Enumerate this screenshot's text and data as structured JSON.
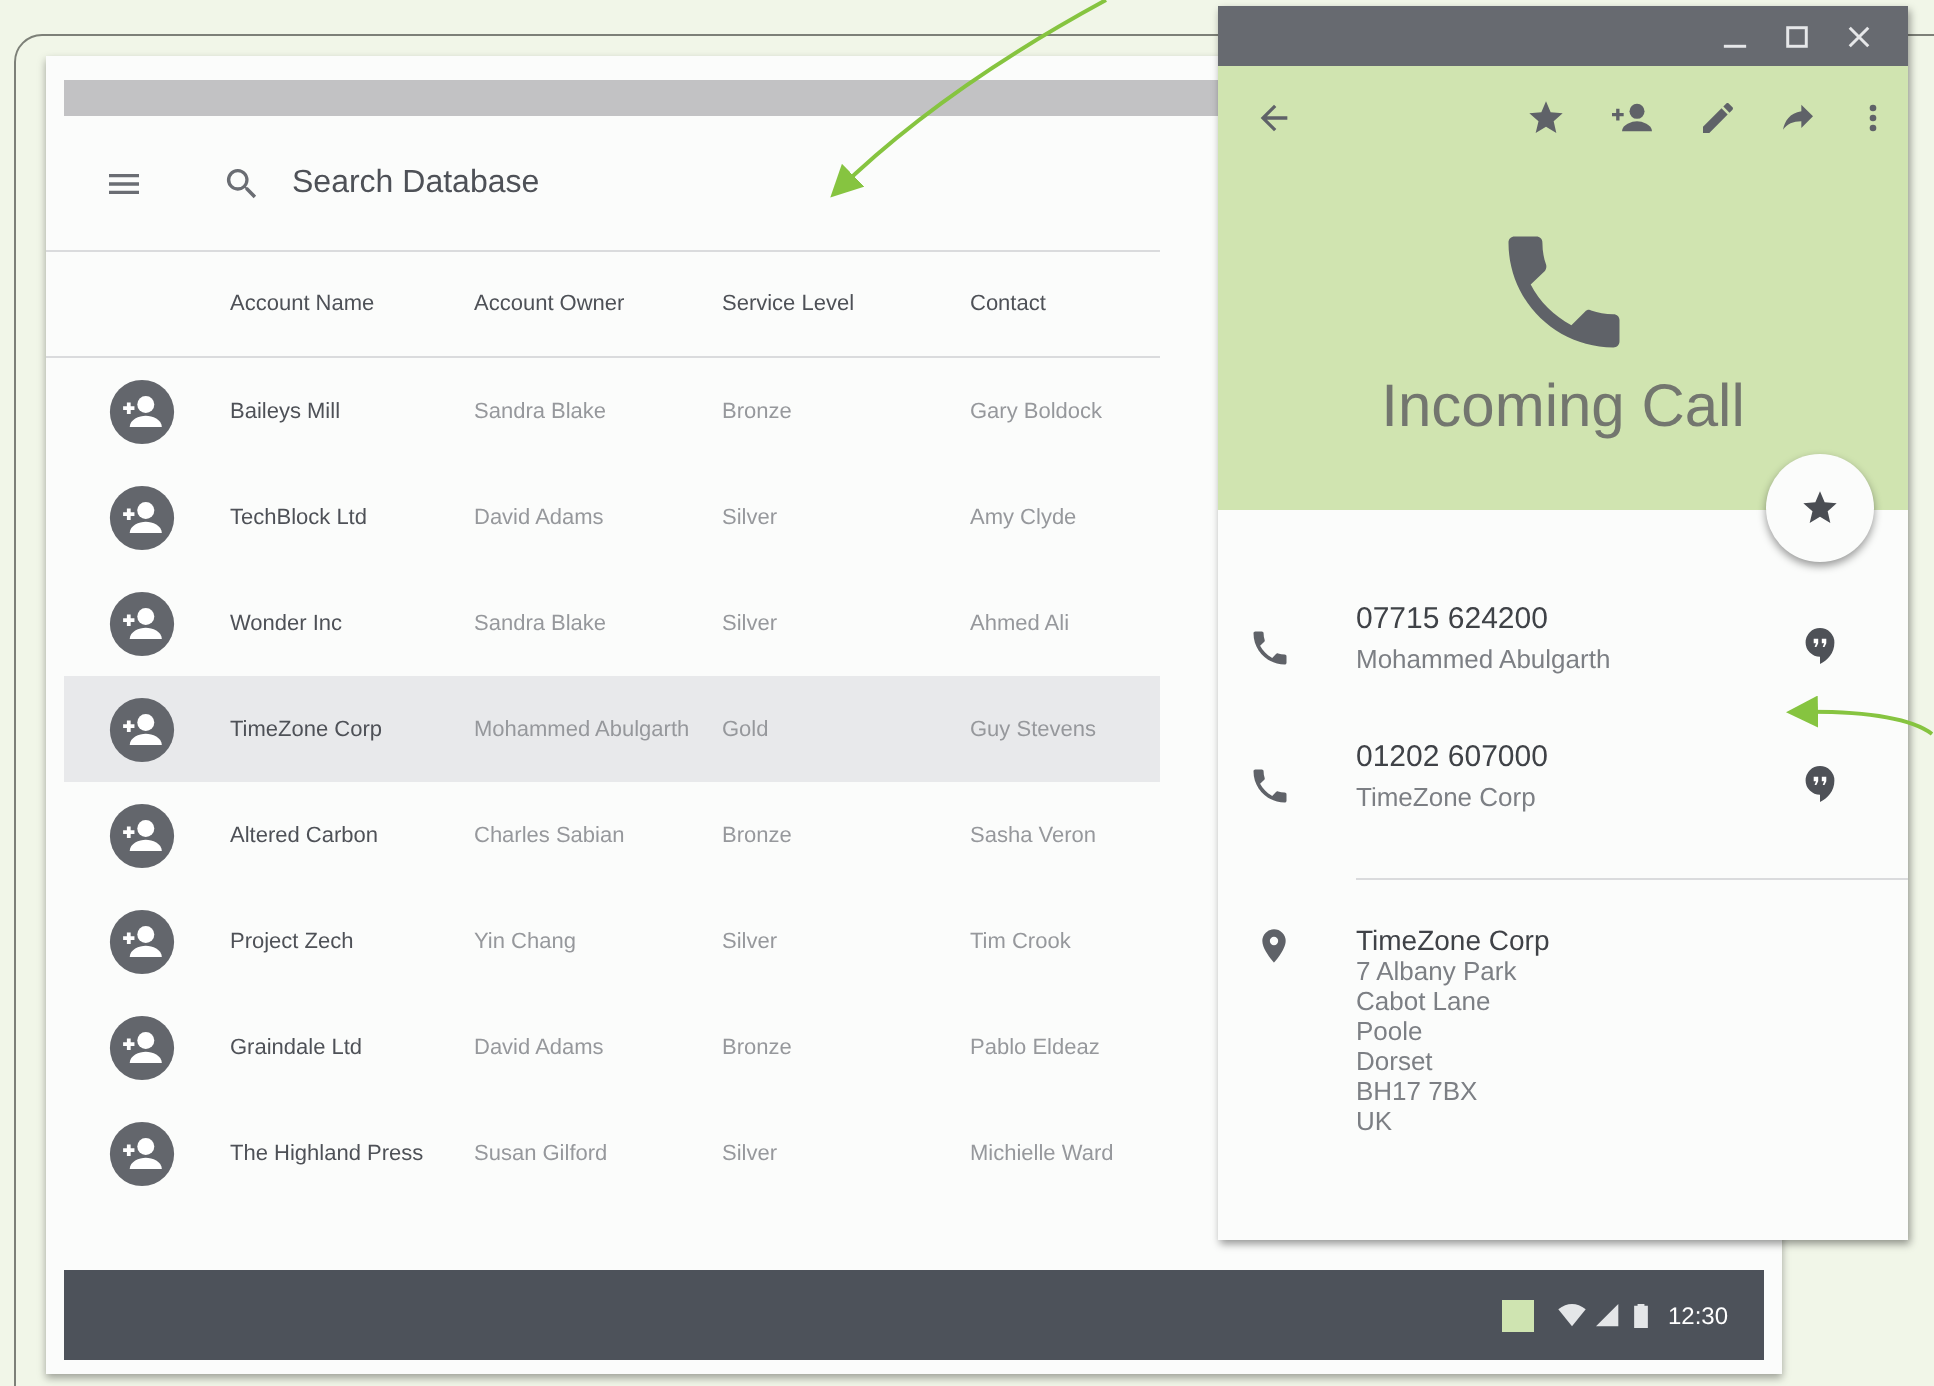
{
  "search": {
    "placeholder": "Search Database"
  },
  "table": {
    "columns": [
      "Account Name",
      "Account Owner",
      "Service Level",
      "Contact"
    ],
    "rows": [
      {
        "cells": [
          "Baileys Mill",
          "Sandra Blake",
          "Bronze",
          "Gary Boldock"
        ],
        "selected": false
      },
      {
        "cells": [
          "TechBlock Ltd",
          "David Adams",
          "Silver",
          "Amy Clyde"
        ],
        "selected": false
      },
      {
        "cells": [
          "Wonder Inc",
          "Sandra Blake",
          "Silver",
          "Ahmed Ali"
        ],
        "selected": false
      },
      {
        "cells": [
          "TimeZone Corp",
          "Mohammed Abulgarth",
          "Gold",
          "Guy Stevens"
        ],
        "selected": true
      },
      {
        "cells": [
          "Altered Carbon",
          "Charles Sabian",
          "Bronze",
          "Sasha Veron"
        ],
        "selected": false
      },
      {
        "cells": [
          "Project Zech",
          "Yin Chang",
          "Silver",
          "Tim Crook"
        ],
        "selected": false
      },
      {
        "cells": [
          "Graindale Ltd",
          "David Adams",
          "Bronze",
          "Pablo Eldeaz"
        ],
        "selected": false
      },
      {
        "cells": [
          "The Highland Press",
          "Susan Gilford",
          "Silver",
          "Michielle Ward"
        ],
        "selected": false
      }
    ]
  },
  "taskbar": {
    "time": "12:30"
  },
  "call": {
    "title": "Incoming Call",
    "numbers": [
      {
        "number": "07715 624200",
        "name": "Mohammed Abulgarth"
      },
      {
        "number": "01202 607000",
        "name": "TimeZone Corp"
      }
    ],
    "address": {
      "title": "TimeZone Corp",
      "lines": [
        "7 Albany Park",
        "Cabot Lane",
        "Poole",
        "Dorset",
        "BH17 7BX",
        "UK"
      ]
    }
  }
}
